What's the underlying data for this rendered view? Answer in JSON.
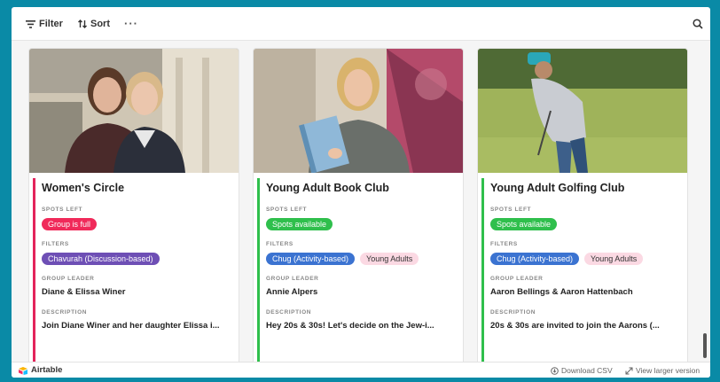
{
  "toolbar": {
    "filter_label": "Filter",
    "sort_label": "Sort",
    "more_label": "···"
  },
  "labels": {
    "spots_left": "SPOTS LEFT",
    "filters": "FILTERS",
    "group_leader": "GROUP LEADER",
    "description": "DESCRIPTION"
  },
  "cards": [
    {
      "title": "Women's Circle",
      "accent": "#e3245b",
      "spots": {
        "text": "Group is full",
        "bg": "#f02a5a",
        "fg": "#ffffff"
      },
      "filters": [
        {
          "text": "Chavurah (Discussion-based)",
          "bg": "#6e4fb5",
          "fg": "#ffffff"
        }
      ],
      "leader": "Diane & Elissa Winer",
      "description": "Join Diane Winer and her daughter Elissa i..."
    },
    {
      "title": "Young Adult Book Club",
      "accent": "#2fbf4c",
      "spots": {
        "text": "Spots available",
        "bg": "#2fbf4c",
        "fg": "#ffffff"
      },
      "filters": [
        {
          "text": "Chug (Activity-based)",
          "bg": "#3b73d1",
          "fg": "#ffffff"
        },
        {
          "text": "Young Adults",
          "bg": "#fbd9e3",
          "fg": "#333333"
        }
      ],
      "leader": "Annie Alpers",
      "description": "Hey 20s & 30s! Let's decide on the Jew-i..."
    },
    {
      "title": "Young Adult Golfing Club",
      "accent": "#2fbf4c",
      "spots": {
        "text": "Spots available",
        "bg": "#2fbf4c",
        "fg": "#ffffff"
      },
      "filters": [
        {
          "text": "Chug (Activity-based)",
          "bg": "#3b73d1",
          "fg": "#ffffff"
        },
        {
          "text": "Young Adults",
          "bg": "#fbd9e3",
          "fg": "#333333"
        }
      ],
      "leader": "Aaron Bellings & Aaron Hattenbach",
      "description": "20s & 30s are invited to join the Aarons (..."
    }
  ],
  "footer": {
    "brand": "Airtable",
    "download": "Download CSV",
    "view_larger": "View larger version"
  }
}
